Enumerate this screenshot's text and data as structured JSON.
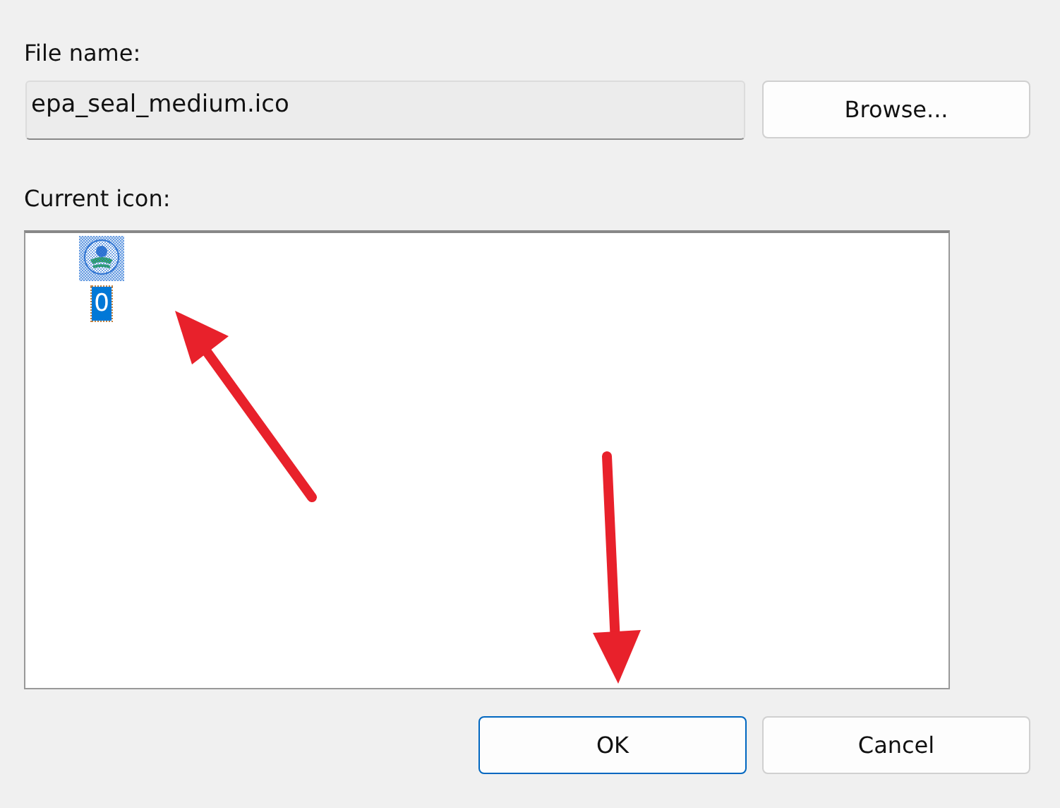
{
  "file_name": {
    "label": "File name:",
    "value": "epa_seal_medium.ico"
  },
  "browse_button": "Browse...",
  "icon_list": {
    "label": "Current icon:",
    "items": [
      {
        "label": "0",
        "selected": true
      }
    ]
  },
  "buttons": [
    {
      "label": "OK",
      "default": true
    },
    {
      "label": "Cancel",
      "default": false
    }
  ]
}
